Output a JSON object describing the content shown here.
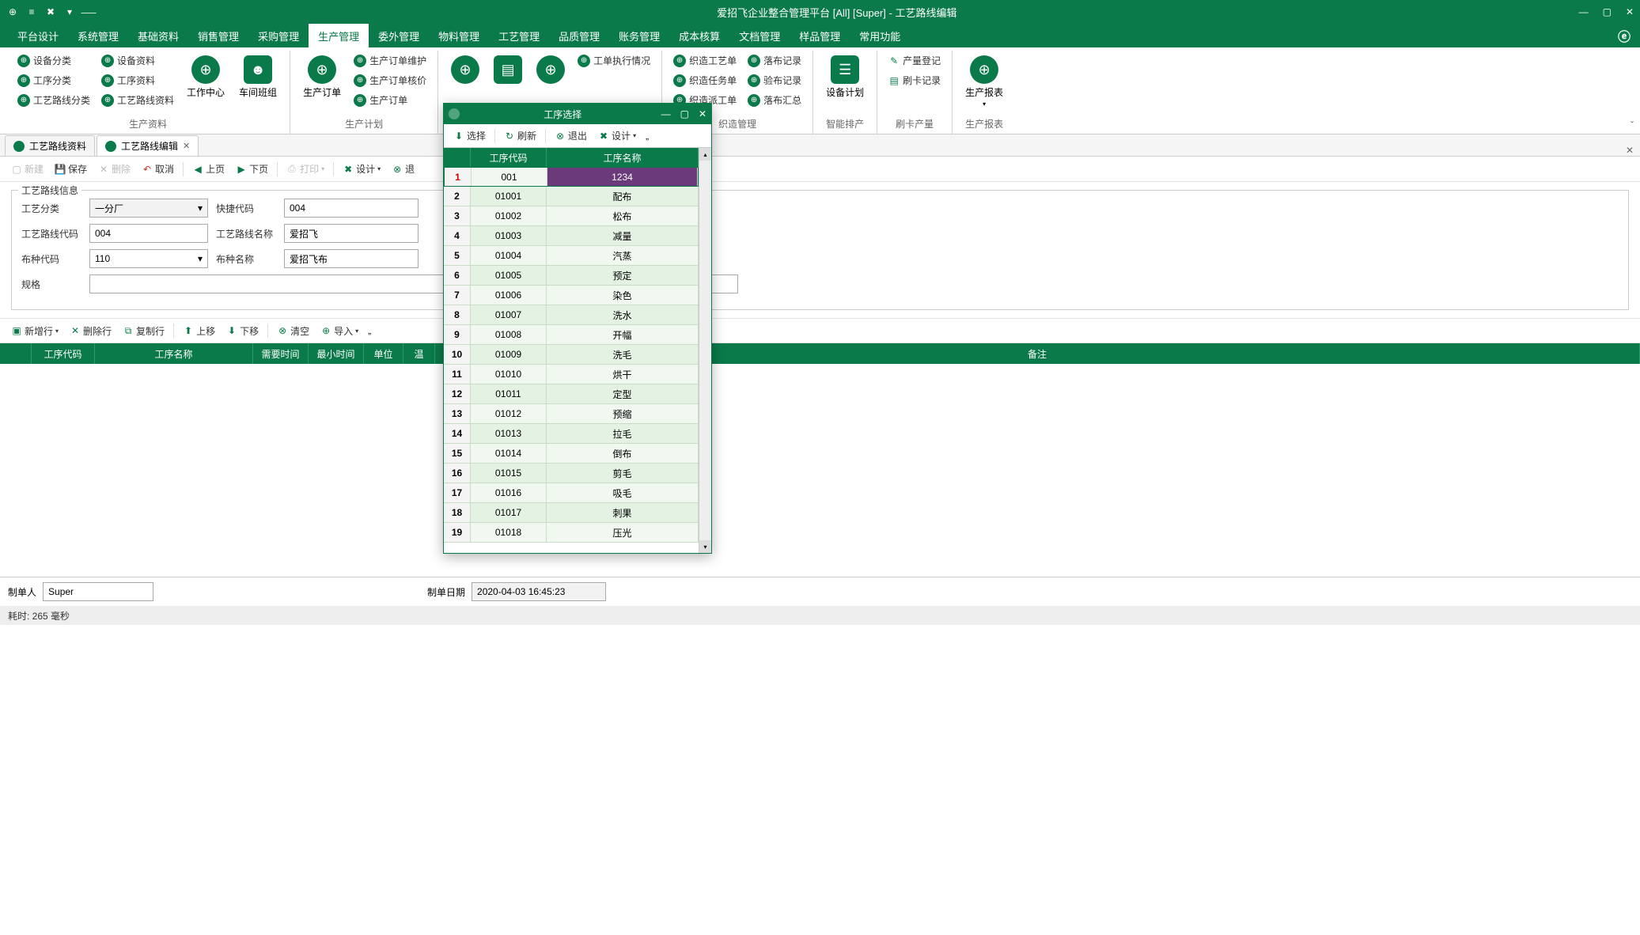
{
  "app": {
    "title": "爱招飞企业整合管理平台 [All] [Super] - 工艺路线编辑"
  },
  "menu": {
    "items": [
      "平台设计",
      "系统管理",
      "基础资料",
      "销售管理",
      "采购管理",
      "生产管理",
      "委外管理",
      "物料管理",
      "工艺管理",
      "品质管理",
      "账务管理",
      "成本核算",
      "文档管理",
      "样品管理",
      "常用功能"
    ],
    "active_index": 5
  },
  "ribbon": {
    "groups": [
      {
        "label": "生产资料",
        "small_cols": [
          [
            "设备分类",
            "工序分类",
            "工艺路线分类"
          ],
          [
            "设备资料",
            "工序资料",
            "工艺路线资料"
          ]
        ],
        "big": [
          {
            "label": "工作中心"
          },
          {
            "label": "车间班组"
          }
        ]
      },
      {
        "label": "生产计划",
        "big": [
          {
            "label": "生产订单"
          }
        ],
        "small_cols": [
          [
            "生产订单维护",
            "生产订单核价",
            "生产订单"
          ]
        ]
      },
      {
        "label": "",
        "big": [
          {
            "label": ""
          },
          {
            "label": ""
          },
          {
            "label": ""
          }
        ],
        "small_cols": [
          [
            "工单执行情况"
          ]
        ]
      },
      {
        "label": "织造管理",
        "small_cols": [
          [
            "织造工艺单",
            "织造任务单",
            "织造派工单"
          ],
          [
            "落布记录",
            "验布记录",
            "落布汇总"
          ]
        ]
      },
      {
        "label": "智能排产",
        "big": [
          {
            "label": "设备计划"
          }
        ]
      },
      {
        "label": "刷卡产量",
        "small_cols": [
          [
            "产量登记",
            "刷卡记录"
          ]
        ]
      },
      {
        "label": "生产报表",
        "big": [
          {
            "label": "生产报表"
          }
        ]
      }
    ]
  },
  "doc_tabs": [
    {
      "label": "工艺路线资料",
      "active": false
    },
    {
      "label": "工艺路线编辑",
      "active": true
    }
  ],
  "toolbar1": {
    "new": "新建",
    "save": "保存",
    "delete": "删除",
    "cancel": "取消",
    "prev": "上页",
    "next": "下页",
    "print": "打印",
    "design": "设计",
    "exit": "退"
  },
  "form": {
    "legend": "工艺路线信息",
    "cat_label": "工艺分类",
    "cat_value": "一分厂",
    "quick_label": "快捷代码",
    "quick_value": "004",
    "code_label": "工艺路线代码",
    "code_value": "004",
    "name_label": "工艺路线名称",
    "name_value": "爱招飞",
    "cloth_code_label": "布种代码",
    "cloth_code_value": "110",
    "cloth_name_label": "布种名称",
    "cloth_name_value": "爱招飞布",
    "spec_label": "规格",
    "spec_value": ""
  },
  "toolbar2": {
    "addrow": "新增行",
    "delrow": "删除行",
    "copyrow": "复制行",
    "moveup": "上移",
    "movedown": "下移",
    "clear": "清空",
    "import": "导入"
  },
  "grid_headers": [
    "",
    "工序代码",
    "工序名称",
    "需要时间",
    "最小时间",
    "单位",
    "温",
    "备注"
  ],
  "footer": {
    "creator_label": "制单人",
    "creator_value": "Super",
    "date_label": "制单日期",
    "date_value": "2020-04-03 16:45:23"
  },
  "status": {
    "text": "耗时: 265 毫秒"
  },
  "modal": {
    "title": "工序选择",
    "tb": {
      "select": "选择",
      "refresh": "刷新",
      "exit": "退出",
      "design": "设计"
    },
    "headers": [
      "",
      "工序代码",
      "工序名称"
    ],
    "rows": [
      {
        "n": "1",
        "code": "001",
        "name": "1234",
        "sel": true
      },
      {
        "n": "2",
        "code": "01001",
        "name": "配布"
      },
      {
        "n": "3",
        "code": "01002",
        "name": "松布"
      },
      {
        "n": "4",
        "code": "01003",
        "name": "减量"
      },
      {
        "n": "5",
        "code": "01004",
        "name": "汽蒸"
      },
      {
        "n": "6",
        "code": "01005",
        "name": "预定"
      },
      {
        "n": "7",
        "code": "01006",
        "name": "染色"
      },
      {
        "n": "8",
        "code": "01007",
        "name": "洗水"
      },
      {
        "n": "9",
        "code": "01008",
        "name": "开幅"
      },
      {
        "n": "10",
        "code": "01009",
        "name": "洗毛"
      },
      {
        "n": "11",
        "code": "01010",
        "name": "烘干"
      },
      {
        "n": "12",
        "code": "01011",
        "name": "定型"
      },
      {
        "n": "13",
        "code": "01012",
        "name": "预缩"
      },
      {
        "n": "14",
        "code": "01013",
        "name": "拉毛"
      },
      {
        "n": "15",
        "code": "01014",
        "name": "倒布"
      },
      {
        "n": "16",
        "code": "01015",
        "name": "剪毛"
      },
      {
        "n": "17",
        "code": "01016",
        "name": "吸毛"
      },
      {
        "n": "18",
        "code": "01017",
        "name": "刺果"
      },
      {
        "n": "19",
        "code": "01018",
        "name": "压光"
      }
    ]
  }
}
